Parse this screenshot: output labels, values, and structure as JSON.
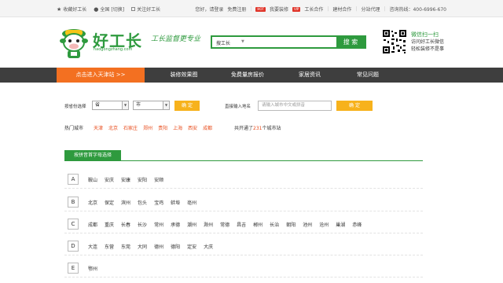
{
  "topbar": {
    "favorite": "收藏好工长",
    "region": "全国",
    "switch": "[切换]",
    "follow": "关注好工长",
    "greeting": "您好，请登录",
    "register": "免费注册",
    "tag_hot": "HOT",
    "decorate": "我要装修",
    "tag_vip": "VIP",
    "foreman_coop": "工长合作",
    "material_coop": "建材合作",
    "branch_agent": "分站代理",
    "hotline": "咨询热线：400-6996-670"
  },
  "header": {
    "brand": "好工长",
    "domain": "haogongzhang.com",
    "slogan": "工长监督更专业",
    "search": {
      "scope": "搜工长",
      "button": "搜 索",
      "value": ""
    },
    "wechat": {
      "line1": "微信扫一扫",
      "line2": "访问好工长微信",
      "line3": "轻松装修不是事"
    }
  },
  "nav": {
    "items": [
      "点击进入天津站 >>",
      "装修效果图",
      "免费量房报价",
      "家居资讯",
      "常见问题"
    ]
  },
  "filter": {
    "province_label": "按省份选择",
    "province_value": "省",
    "city_value": "市",
    "confirm": "确 定",
    "direct_label": "直接输入地名",
    "direct_placeholder": "请输入城市中文或拼音",
    "hot_label": "热门城市",
    "hot_cities": [
      "天津",
      "北京",
      "石家庄",
      "郑州",
      "贵阳",
      "上海",
      "西安",
      "成都"
    ],
    "total_prefix": "共开通了",
    "total_count": "231",
    "total_suffix": "个城市站"
  },
  "pinyin": {
    "button": "按拼音首字母选择",
    "rows": [
      {
        "letter": "A",
        "cities": [
          "鞍山",
          "安庆",
          "安康",
          "安阳",
          "安顺"
        ]
      },
      {
        "letter": "B",
        "cities": [
          "北京",
          "保定",
          "滨州",
          "包头",
          "宝鸡",
          "蚌埠",
          "亳州"
        ]
      },
      {
        "letter": "C",
        "cities": [
          "成都",
          "重庆",
          "长春",
          "长沙",
          "常州",
          "承德",
          "潮州",
          "滁州",
          "常德",
          "昌吉",
          "郴州",
          "长治",
          "朝阳",
          "池州",
          "沧州",
          "巢湖",
          "赤峰"
        ]
      },
      {
        "letter": "D",
        "cities": [
          "大连",
          "东营",
          "东莞",
          "大同",
          "德州",
          "德阳",
          "定安",
          "大庆"
        ]
      },
      {
        "letter": "E",
        "cities": [
          "鄂州"
        ]
      }
    ]
  }
}
